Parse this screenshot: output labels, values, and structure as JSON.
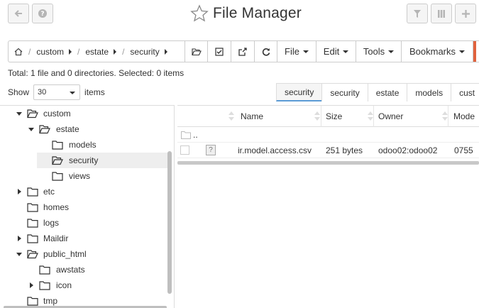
{
  "header": {
    "title": "File Manager",
    "back_icon": "back-arrow-icon",
    "help_icon": "help-icon",
    "filter_icon": "filter-icon",
    "columns_icon": "columns-icon",
    "add_icon": "plus-icon"
  },
  "toolbar": {
    "breadcrumb": [
      "custom",
      "estate",
      "security"
    ],
    "menus": {
      "file": "File",
      "edit": "Edit",
      "tools": "Tools",
      "bookmarks": "Bookmarks"
    }
  },
  "summary": "Total: 1 file and 0 directories. Selected: 0 items",
  "show": {
    "label_before": "Show",
    "value": "30",
    "label_after": "items"
  },
  "tabs": [
    "security",
    "security",
    "estate",
    "models",
    "cust"
  ],
  "tree": [
    {
      "label": "custom",
      "toggle": "down",
      "open": true
    },
    {
      "label": "estate",
      "toggle": "down",
      "open": true
    },
    {
      "label": "models",
      "toggle": "none",
      "open": false
    },
    {
      "label": "security",
      "toggle": "none",
      "open": true,
      "selected": true
    },
    {
      "label": "views",
      "toggle": "none",
      "open": false
    },
    {
      "label": "etc",
      "toggle": "right",
      "open": false
    },
    {
      "label": "homes",
      "toggle": "none",
      "open": false
    },
    {
      "label": "logs",
      "toggle": "none",
      "open": false
    },
    {
      "label": "Maildir",
      "toggle": "right",
      "open": false
    },
    {
      "label": "public_html",
      "toggle": "down",
      "open": true
    },
    {
      "label": "awstats",
      "toggle": "none",
      "open": false
    },
    {
      "label": "icon",
      "toggle": "right",
      "open": false
    },
    {
      "label": "tmp",
      "toggle": "none",
      "open": false
    }
  ],
  "files": {
    "columns": [
      "Name",
      "Size",
      "Owner",
      "Mode"
    ],
    "parent_label": "..",
    "rows": [
      {
        "name": "ir.model.access.csv",
        "size": "251 bytes",
        "owner": "odoo02:odoo02",
        "mode": "0755",
        "icon": "unknown-file-icon"
      }
    ]
  }
}
